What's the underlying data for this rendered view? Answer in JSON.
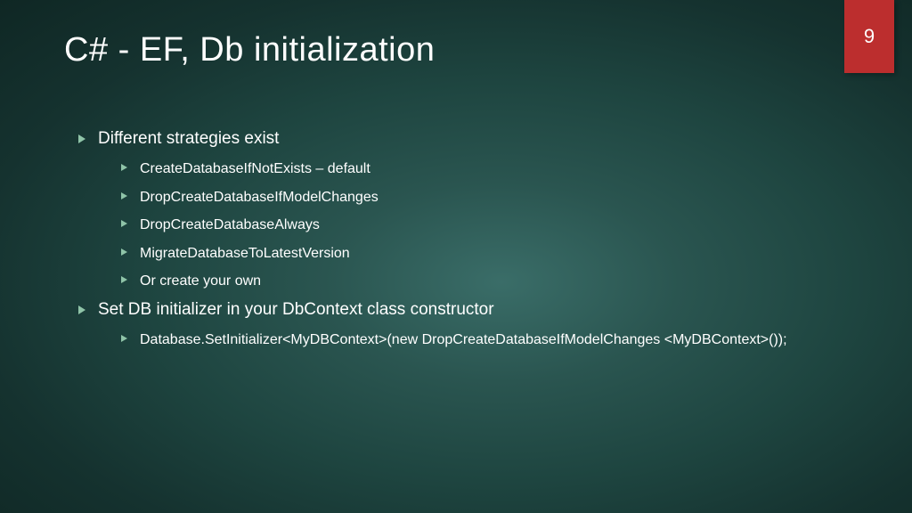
{
  "page_number": "9",
  "title": "C# - EF, Db initialization",
  "bullets": {
    "b1": "Different strategies exist",
    "b1_1": "CreateDatabaseIfNotExists – default",
    "b1_2": "DropCreateDatabaseIfModelChanges",
    "b1_3": "DropCreateDatabaseAlways",
    "b1_4": "MigrateDatabaseToLatestVersion",
    "b1_5": "Or create your own",
    "b2": "Set DB initializer in your DbContext class constructor",
    "b2_1": "Database.SetInitializer<MyDBContext>(new DropCreateDatabaseIfModelChanges <MyDBContext>());"
  }
}
